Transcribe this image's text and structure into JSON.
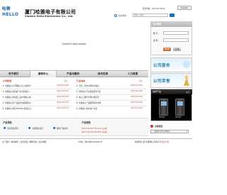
{
  "header": {
    "logo_cn": "哈雅",
    "logo_en": "HELLO",
    "company_cn": "厦门哈雅电子有限公司",
    "company_en": "Xiamen Hello Electronics Co., Ltd.",
    "phone": "服务热线：400-000-0000",
    "lang_button": "English",
    "search_label": "站内搜索",
    "search_placeholder": "请输入关键字"
  },
  "plugin": {
    "message": "Couldn't load plugin."
  },
  "nav": {
    "items": [
      {
        "label": "关于我们"
      },
      {
        "label": "新闻中心"
      },
      {
        "label": "产品与服务"
      },
      {
        "label": "技术支持"
      },
      {
        "label": "人力资源"
      }
    ]
  },
  "news_left": {
    "title": "公司新闻",
    "more": "更多",
    "rows": [
      {
        "text": "哈雅电子公司网站正式上线运行...",
        "date": "[2013-04-18]"
      },
      {
        "text": "哈雅电子荣获厦门市高新技术...",
        "date": "[2013-04-10]"
      },
      {
        "text": "哈雅电子参加第二届中国电子展...",
        "date": "[2013-03-22]"
      },
      {
        "text": "哈雅电子新产品发布会圆满成功",
        "date": "[2013-03-15]"
      },
      {
        "text": "哈雅电子通过ISO9001质量认证",
        "date": "[2013-02-27]"
      }
    ]
  },
  "news_right": {
    "title": "行业动态",
    "more": "更多",
    "rows": [
      {
        "text": "手机、安防市场前景看好",
        "date": "[2013-04-16]"
      },
      {
        "text": "国内电子行业发展趋势分析",
        "date": "[2013-04-08]"
      },
      {
        "text": "电子元器件市场价格走势",
        "date": "[2013-03-30]"
      },
      {
        "text": "哈雅电子产品畅销海外市场",
        "date": "[2013-03-18]"
      },
      {
        "text": "哈雅电子将参加广交会",
        "date": "[2013-03-05]"
      }
    ]
  },
  "products": {
    "title": "产品导航",
    "items": [
      {
        "label": "安防监控系列"
      },
      {
        "label": "对讲通信系列"
      },
      {
        "label": "数码产品系列"
      }
    ],
    "right_title": "产品更新",
    "right_rows": [
      {
        "text": "[2013-04-18] HTP-7001 对讲机"
      },
      {
        "text": "[2013-04-10] HTP-7002 对讲机"
      }
    ]
  },
  "login": {
    "title": "用户登录",
    "user_label": "帐 号：",
    "pass_label": "密 码：",
    "login_btn": "登 录",
    "reg_btn": "注 册"
  },
  "banners": [
    {
      "text": "公司服务"
    },
    {
      "text": "公司荣誉"
    }
  ],
  "product_show": {
    "title": "最新产品",
    "more": "更多",
    "models": [
      {
        "label": "HT-T01"
      },
      {
        "label": "HT-T02"
      }
    ]
  },
  "links": {
    "title": "友情链接",
    "select_value": "—请选择合作伙伴网站—"
  },
  "footer": {
    "links": "关于我们 | 联系我们 | 意见反馈 | 网站导航 | 站点地图",
    "icp": "ICP备：闽ICP备12000001号",
    "copy_prefix": "版权所有 厦门哈雅电子有限公司 ",
    "copy_link": "技术支持"
  },
  "colors": {
    "brand_blue": "#1a6fbf",
    "accent_red": "#c0392b"
  }
}
